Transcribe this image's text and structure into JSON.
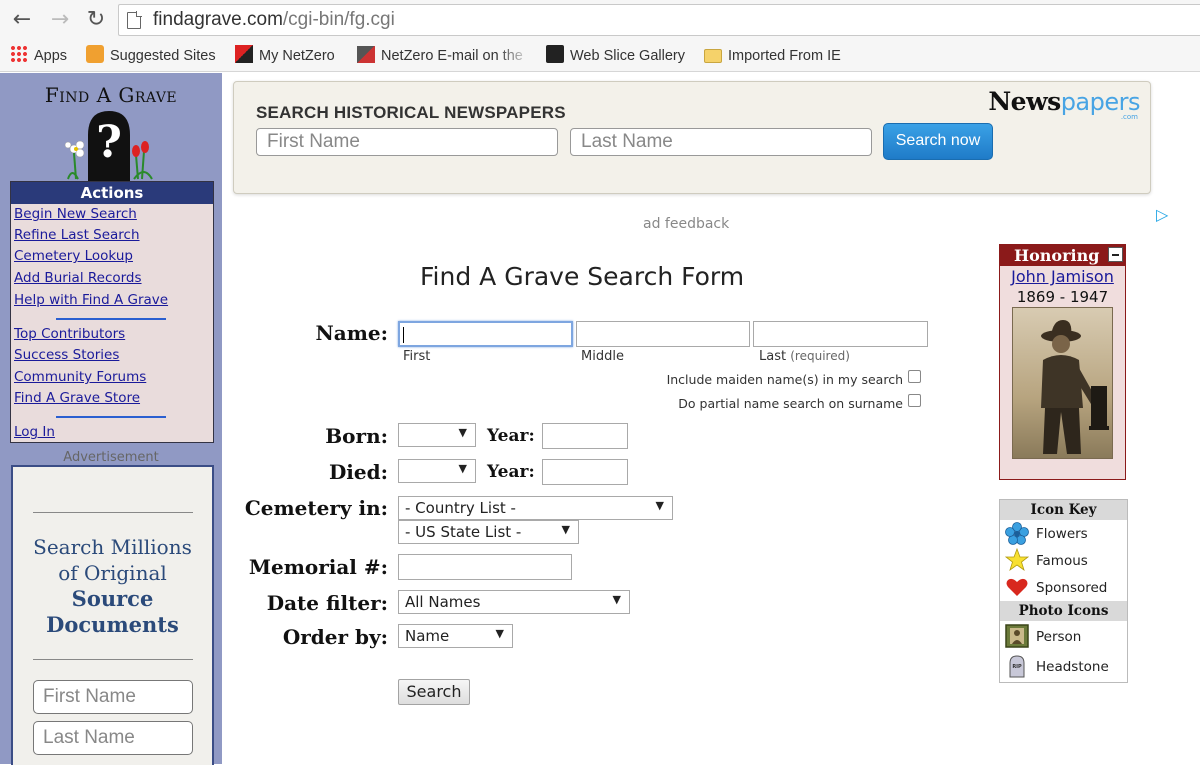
{
  "browser": {
    "url_host": "findagrave.com",
    "url_path": "/cgi-bin/fg.cgi",
    "bookmarks": [
      {
        "label": "Apps",
        "icon": "apps-grid-icon"
      },
      {
        "label": "Suggested Sites",
        "icon": "suggested-sites-icon"
      },
      {
        "label": "My NetZero",
        "icon": "netzero-icon"
      },
      {
        "label": "NetZero E-mail on the",
        "icon": "netzero-mail-icon"
      },
      {
        "label": "Web Slice Gallery",
        "icon": "web-slice-icon"
      },
      {
        "label": "Imported From IE",
        "icon": "folder-icon"
      }
    ]
  },
  "sidebar": {
    "logo_text": "Find A Grave",
    "actions_title": "Actions",
    "links_group1": [
      "Begin New Search",
      "Refine Last Search",
      "Cemetery Lookup",
      "Add Burial Records",
      "Help with Find A Grave"
    ],
    "links_group2": [
      "Top Contributors",
      "Success Stories",
      "Community Forums",
      "Find A Grave Store"
    ],
    "login": "Log In",
    "ad_label": "Advertisement",
    "ad": {
      "line1": "Search Millions",
      "line2": "of Original",
      "bold1": "Source",
      "bold2": "Documents",
      "first_placeholder": "First Name",
      "last_placeholder": "Last Name"
    }
  },
  "newspapers": {
    "heading": "SEARCH HISTORICAL NEWSPAPERS",
    "first_placeholder": "First Name",
    "last_placeholder": "Last Name",
    "button": "Search now",
    "logo_main": "News",
    "logo_accent": "papers",
    "logo_suffix": ".com",
    "ad_feedback": "ad feedback"
  },
  "form": {
    "title": "Find A Grave Search Form",
    "name_label": "Name:",
    "first_sub": "First",
    "middle_sub": "Middle",
    "last_sub": "Last",
    "required": "(required)",
    "maiden_option": "Include maiden name(s) in my search",
    "partial_option": "Do partial name search on surname",
    "born_label": "Born:",
    "died_label": "Died:",
    "year_label": "Year:",
    "cemetery_label": "Cemetery in:",
    "country_select": "- Country List -",
    "state_select": "- US State List -",
    "memorial_label": "Memorial #:",
    "date_filter_label": "Date filter:",
    "date_filter_value": "All Names",
    "order_label": "Order by:",
    "order_value": "Name",
    "search_button": "Search"
  },
  "honoring": {
    "title": "Honoring",
    "name": "John Jamison",
    "years": "1869 - 1947"
  },
  "icon_key": {
    "title": "Icon Key",
    "items": [
      {
        "label": "Flowers",
        "icon": "flower-icon"
      },
      {
        "label": "Famous",
        "icon": "star-icon"
      },
      {
        "label": "Sponsored",
        "icon": "heart-icon"
      }
    ],
    "photo_title": "Photo Icons",
    "photo_items": [
      {
        "label": "Person",
        "icon": "person-photo-icon"
      },
      {
        "label": "Headstone",
        "icon": "headstone-icon"
      }
    ]
  }
}
